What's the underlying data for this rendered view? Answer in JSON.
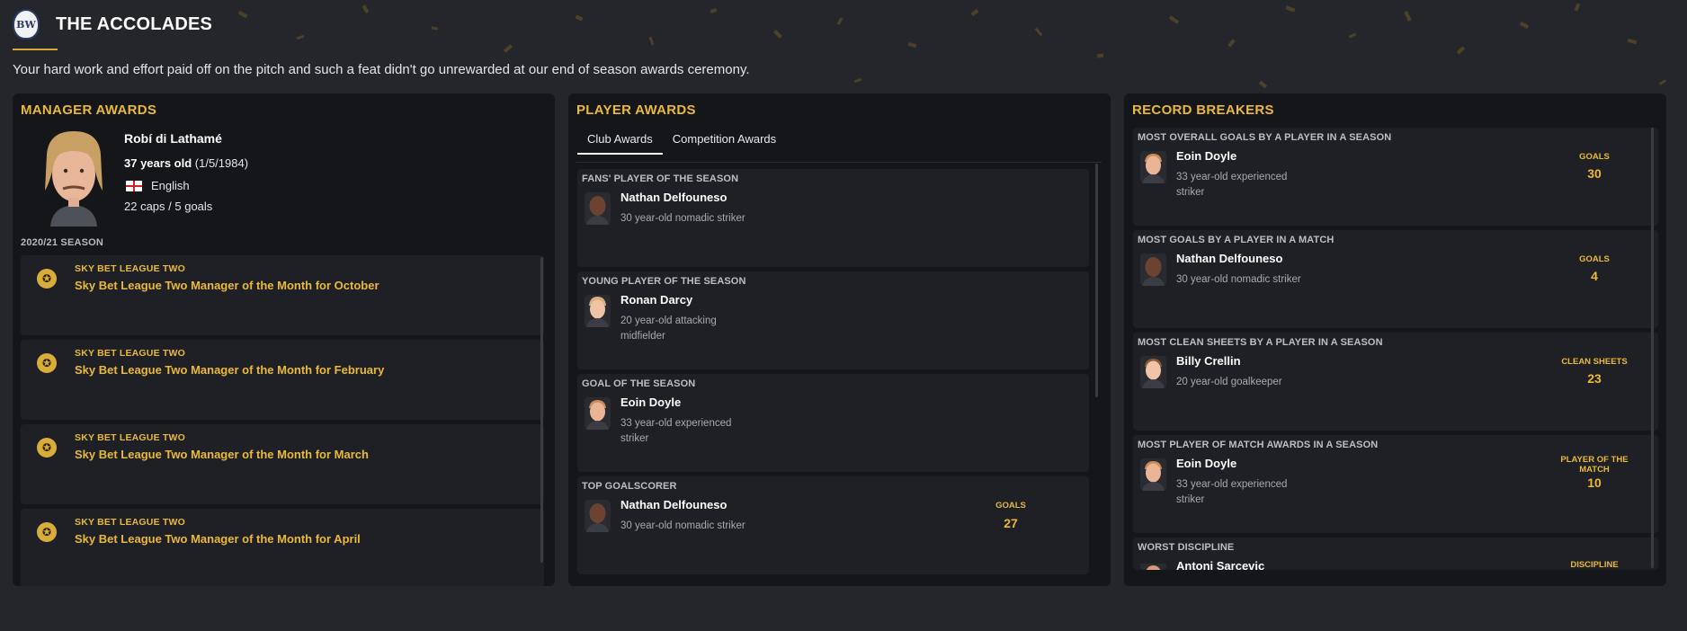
{
  "header": {
    "crest_text": "BW",
    "title": "THE ACCOLADES",
    "intro": "Your hard work and effort paid off on the pitch and such a feat didn't go unrewarded at our end of season awards ceremony."
  },
  "manager": {
    "panel_title": "MANAGER AWARDS",
    "name": "Robí di Lathamé",
    "age_label": "37 years old",
    "dob": "(1/5/1984)",
    "nationality": "English",
    "caps": "22 caps / 5 goals",
    "season_label": "2020/21 SEASON",
    "awards": [
      {
        "competition": "SKY BET LEAGUE TWO",
        "award": "Sky Bet League Two Manager of the Month for October"
      },
      {
        "competition": "SKY BET LEAGUE TWO",
        "award": "Sky Bet League Two Manager of the Month for February"
      },
      {
        "competition": "SKY BET LEAGUE TWO",
        "award": "Sky Bet League Two Manager of the Month for March"
      },
      {
        "competition": "SKY BET LEAGUE TWO",
        "award": "Sky Bet League Two Manager of the Month for April"
      }
    ]
  },
  "player_awards": {
    "panel_title": "PLAYER AWARDS",
    "tabs": [
      {
        "label": "Club Awards",
        "active": true
      },
      {
        "label": "Competition Awards",
        "active": false
      }
    ],
    "cards": [
      {
        "label": "FANS' PLAYER OF THE SEASON",
        "name": "Nathan Delfouneso",
        "desc": "30 year-old nomadic striker"
      },
      {
        "label": "YOUNG PLAYER OF THE SEASON",
        "name": "Ronan Darcy",
        "desc": "20 year-old attacking midfielder"
      },
      {
        "label": "GOAL OF THE SEASON",
        "name": "Eoin Doyle",
        "desc": "33 year-old experienced striker"
      },
      {
        "label": "TOP GOALSCORER",
        "name": "Nathan Delfouneso",
        "desc": "30 year-old nomadic striker",
        "stat_label": "GOALS",
        "stat_value": "27"
      }
    ]
  },
  "records": {
    "panel_title": "RECORD BREAKERS",
    "cards": [
      {
        "label": "MOST OVERALL GOALS BY A PLAYER IN A SEASON",
        "name": "Eoin Doyle",
        "desc": "33 year-old experienced striker",
        "stat_label": "GOALS",
        "stat_value": "30"
      },
      {
        "label": "MOST GOALS BY A PLAYER IN A MATCH",
        "name": "Nathan Delfouneso",
        "desc": "30 year-old nomadic striker",
        "stat_label": "GOALS",
        "stat_value": "4"
      },
      {
        "label": "MOST CLEAN SHEETS BY A PLAYER IN A SEASON",
        "name": "Billy Crellin",
        "desc": "20 year-old goalkeeper",
        "stat_label": "CLEAN SHEETS",
        "stat_value": "23"
      },
      {
        "label": "MOST PLAYER OF MATCH AWARDS IN A SEASON",
        "name": "Eoin Doyle",
        "desc": "33 year-old experienced striker",
        "stat_label": "PLAYER OF THE MATCH",
        "stat_value": "10"
      },
      {
        "label": "WORST DISCIPLINE",
        "name": "Antoni Sarcevic",
        "stat_label": "DISCIPLINE"
      }
    ]
  },
  "colors": {
    "accent": "#e9b93a",
    "background": "#25262c",
    "panel": "#151619",
    "card": "#1f2025"
  }
}
